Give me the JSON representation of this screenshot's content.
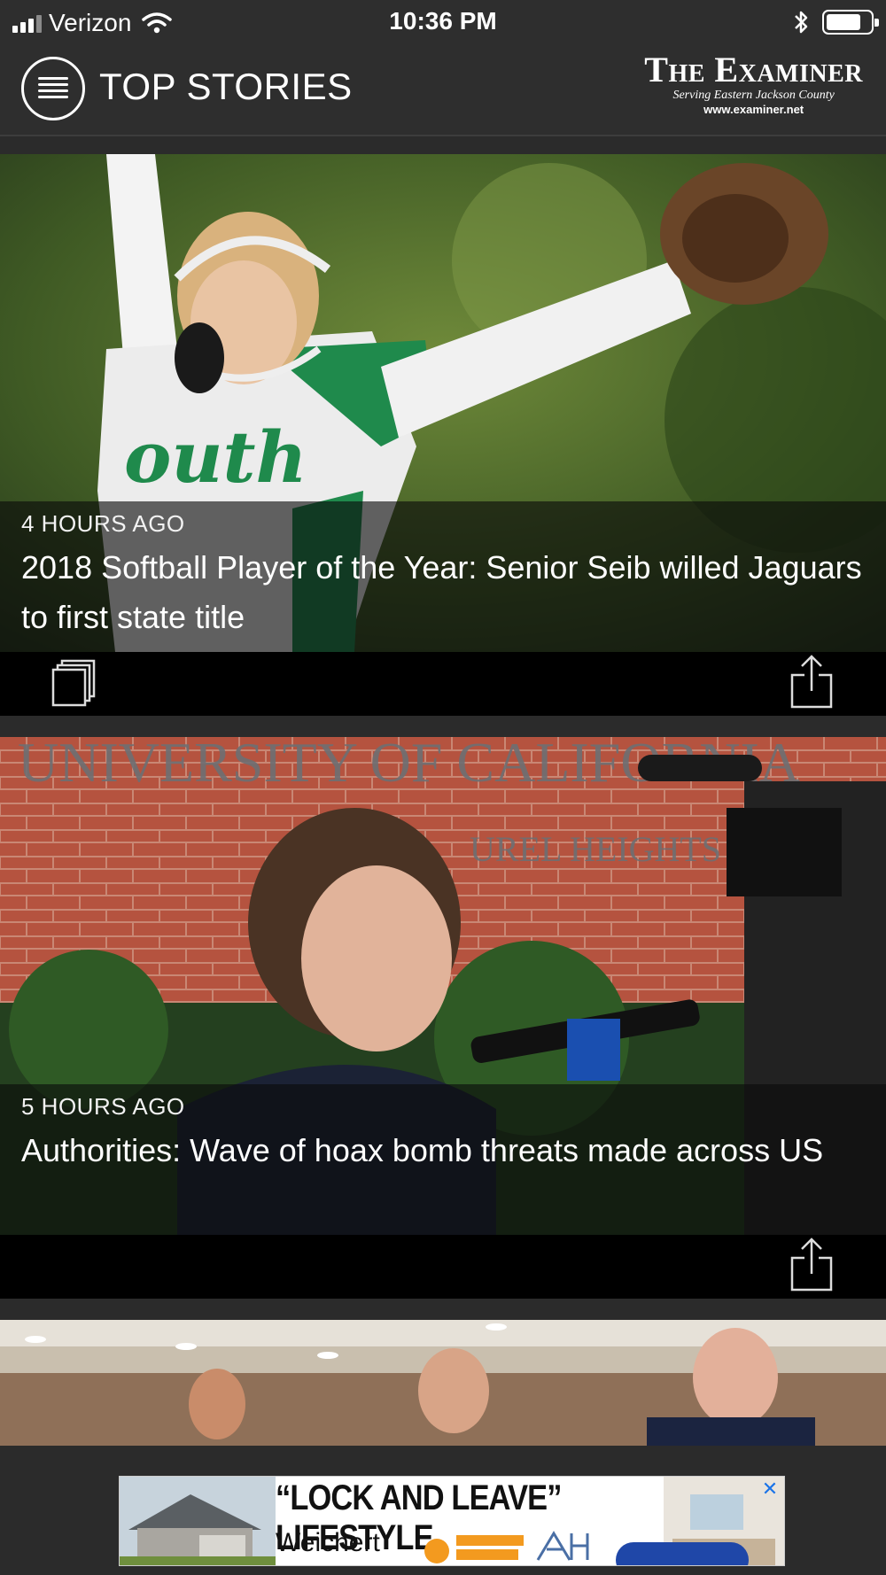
{
  "status_bar": {
    "carrier": "Verizon",
    "time": "10:36 PM",
    "icons": [
      "signal-icon",
      "wifi-icon",
      "bluetooth-icon",
      "battery-icon"
    ]
  },
  "header": {
    "title": "TOP STORIES",
    "brand_name": "The Examiner",
    "brand_tagline": "Serving Eastern Jackson County",
    "brand_url": "www.examiner.net",
    "menu_icon": "hamburger-menu-icon"
  },
  "stories": [
    {
      "time": "4 HOURS AGO",
      "headline": "2018 Softball Player of the Year: Senior Seib willed Jaguars to first state title",
      "image": "softball-pitcher-photo",
      "has_gallery": true
    },
    {
      "time": "5 HOURS AGO",
      "headline": "Authorities: Wave of hoax bomb threats made across US",
      "image": "police-officer-press-photo",
      "has_gallery": false
    },
    {
      "image": "officials-meeting-photo"
    }
  ],
  "ad": {
    "headline": "“LOCK AND LEAVE” LIFESTYLE",
    "brand": "Weichert",
    "close": "✕"
  },
  "colors": {
    "background": "#2b2b2b",
    "header": "#2e2e2e",
    "action_bar": "#000000",
    "text": "#ffffff"
  }
}
